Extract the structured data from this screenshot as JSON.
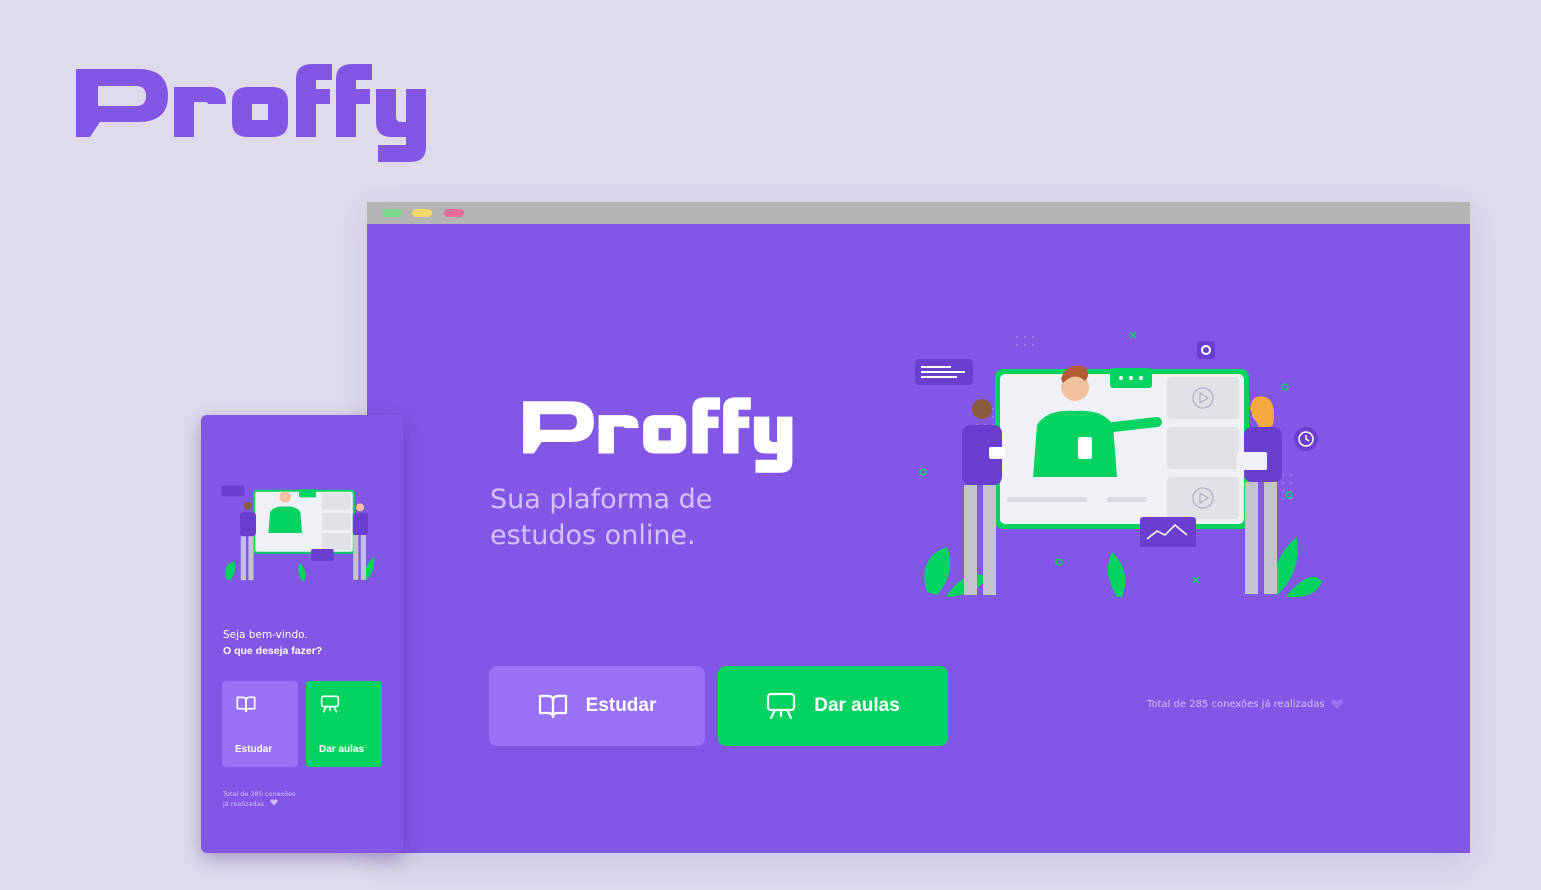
{
  "brand": {
    "name": "Proffy"
  },
  "colors": {
    "background": "#DFDBEC",
    "primary": "#8257E5",
    "primary_light": "#9871F5",
    "secondary": "#04D361",
    "text_in_primary": "#D4C2FF",
    "logo": "#8257E5"
  },
  "desktop": {
    "window_dots": [
      "green",
      "yellow",
      "pink"
    ],
    "logo": "Proffy",
    "tagline_line1": "Sua plaforma de",
    "tagline_line2": "estudos online.",
    "buttons": {
      "study": {
        "label": "Estudar",
        "icon": "book-open-icon"
      },
      "teach": {
        "label": "Dar aulas",
        "icon": "presentation-board-icon"
      }
    },
    "connections": "Total de 285 conexões já realizadas"
  },
  "mobile": {
    "welcome": "Seja bem-vindo.",
    "question": "O que deseja fazer?",
    "buttons": {
      "study": {
        "label": "Estudar",
        "icon": "book-open-icon"
      },
      "teach": {
        "label": "Dar aulas",
        "icon": "presentation-board-icon"
      }
    },
    "connections_line1": "Total de 285 conexões",
    "connections_line2": "já realizadas"
  }
}
